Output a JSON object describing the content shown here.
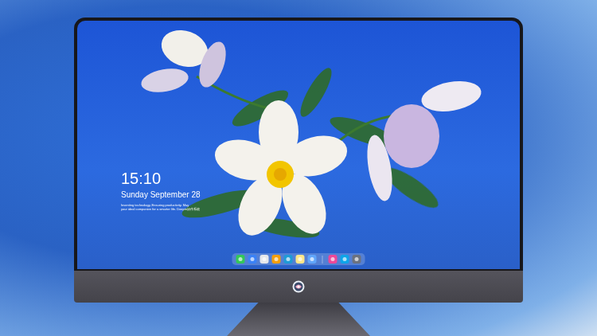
{
  "lock_screen": {
    "time": "15:10",
    "date": "Sunday September 28",
    "tagline": [
      "Inventing technology, Ensuring productivity. May",
      "your ideal companion for a smarter life. Deepin操作系统"
    ]
  }
}
